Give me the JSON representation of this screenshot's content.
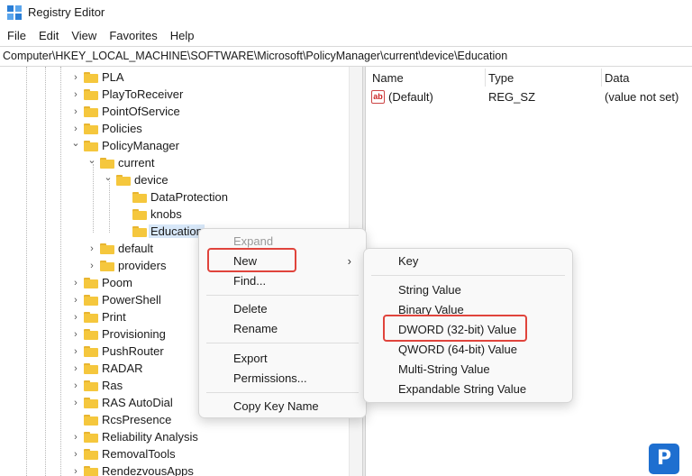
{
  "window": {
    "title": "Registry Editor",
    "icon": "registry-icon"
  },
  "menu": [
    "File",
    "Edit",
    "View",
    "Favorites",
    "Help"
  ],
  "address": "Computer\\HKEY_LOCAL_MACHINE\\SOFTWARE\\Microsoft\\PolicyManager\\current\\device\\Education",
  "tree": {
    "nodes": [
      {
        "label": "PLA",
        "expander": "collapsed"
      },
      {
        "label": "PlayToReceiver",
        "expander": "collapsed"
      },
      {
        "label": "PointOfService",
        "expander": "collapsed"
      },
      {
        "label": "Policies",
        "expander": "collapsed"
      },
      {
        "label": "PolicyManager",
        "expander": "expanded"
      },
      {
        "label": "current",
        "expander": "expanded"
      },
      {
        "label": "device",
        "expander": "expanded"
      },
      {
        "label": "DataProtection",
        "expander": "none"
      },
      {
        "label": "knobs",
        "expander": "none"
      },
      {
        "label": "Education",
        "expander": "none",
        "selected": true
      },
      {
        "label": "default",
        "expander": "collapsed"
      },
      {
        "label": "providers",
        "expander": "collapsed"
      },
      {
        "label": "Poom",
        "expander": "collapsed"
      },
      {
        "label": "PowerShell",
        "expander": "collapsed"
      },
      {
        "label": "Print",
        "expander": "collapsed"
      },
      {
        "label": "Provisioning",
        "expander": "collapsed"
      },
      {
        "label": "PushRouter",
        "expander": "collapsed"
      },
      {
        "label": "RADAR",
        "expander": "collapsed"
      },
      {
        "label": "Ras",
        "expander": "collapsed"
      },
      {
        "label": "RAS AutoDial",
        "expander": "collapsed"
      },
      {
        "label": "RcsPresence",
        "expander": "none"
      },
      {
        "label": "Reliability Analysis",
        "expander": "collapsed"
      },
      {
        "label": "RemovalTools",
        "expander": "collapsed"
      },
      {
        "label": "RendezvousApps",
        "expander": "collapsed"
      }
    ]
  },
  "values_pane": {
    "columns": {
      "name": "Name",
      "type": "Type",
      "data": "Data"
    },
    "rows": [
      {
        "name": "(Default)",
        "type": "REG_SZ",
        "data": "(value not set)",
        "icon": "string-value-icon"
      }
    ]
  },
  "context_menu": {
    "expand": "Expand",
    "new": "New",
    "find": "Find...",
    "delete": "Delete",
    "rename": "Rename",
    "export": "Export",
    "permissions": "Permissions...",
    "copy_key_name": "Copy Key Name"
  },
  "submenu": {
    "key": "Key",
    "string": "String Value",
    "binary": "Binary Value",
    "dword": "DWORD (32-bit) Value",
    "qword": "QWORD (64-bit) Value",
    "multi_string": "Multi-String Value",
    "expandable_string": "Expandable String Value"
  },
  "colors": {
    "highlight": "#e0443c",
    "folder": "#f5c73d",
    "selection": "#d7e7f8"
  },
  "watermark": {
    "letter": "P"
  }
}
